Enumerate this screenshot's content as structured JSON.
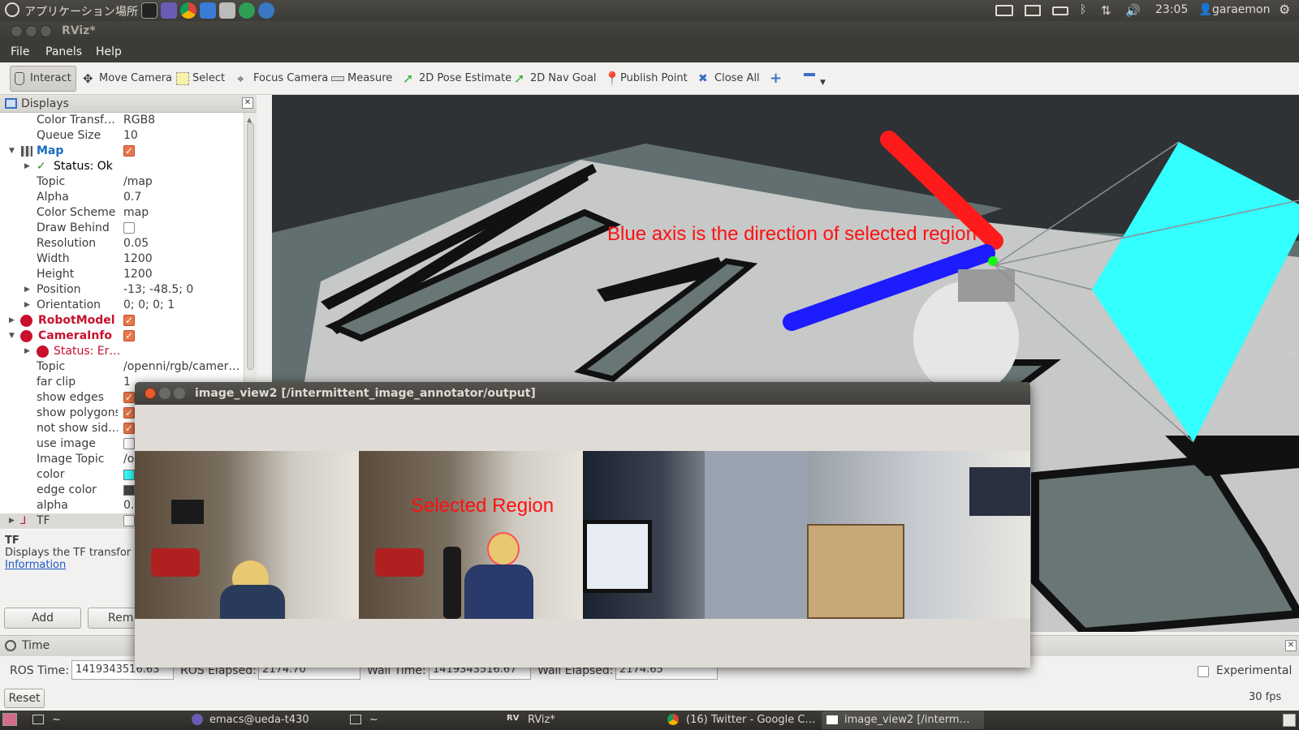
{
  "topbar": {
    "applications": "アプリケーション",
    "places": "場所",
    "clock": "23:05",
    "user": "garaemon"
  },
  "window": {
    "title": "RViz*"
  },
  "menu": {
    "file": "File",
    "panels": "Panels",
    "help": "Help"
  },
  "toolbar": {
    "interact": "Interact",
    "move_camera": "Move Camera",
    "select": "Select",
    "focus_camera": "Focus Camera",
    "measure": "Measure",
    "pose_estimate": "2D Pose Estimate",
    "nav_goal": "2D Nav Goal",
    "publish_point": "Publish Point",
    "close_all": "Close All"
  },
  "displays": {
    "title": "Displays",
    "rows": {
      "color_transf_k": "Color Transf…",
      "color_transf_v": "RGB8",
      "queue_k": "Queue Size",
      "queue_v": "10",
      "map": "Map",
      "status_ok": "Status: Ok",
      "topic_k": "Topic",
      "topic_v": "/map",
      "alpha_k": "Alpha",
      "alpha_v": "0.7",
      "scheme_k": "Color Scheme",
      "scheme_v": "map",
      "draw_behind_k": "Draw Behind",
      "resolution_k": "Resolution",
      "resolution_v": "0.05",
      "width_k": "Width",
      "width_v": "1200",
      "height_k": "Height",
      "height_v": "1200",
      "position_k": "Position",
      "position_v": "-13; -48.5; 0",
      "orientation_k": "Orientation",
      "orientation_v": "0; 0; 0; 1",
      "robotmodel": "RobotModel",
      "camerainfo": "CameraInfo",
      "status_err": "Status: Er…",
      "topic2_k": "Topic",
      "topic2_v": "/openni/rgb/camer…",
      "farclip_k": "far clip",
      "farclip_v": "1",
      "show_edges_k": "show edges",
      "show_polygons_k": "show polygons",
      "not_show_k": "not show sid…",
      "use_image_k": "use image",
      "image_topic_k": "Image Topic",
      "image_topic_v": "/o",
      "color_k": "color",
      "edge_color_k": "edge color",
      "alpha2_k": "alpha",
      "alpha2_v": "0.",
      "tf": "TF"
    },
    "desc_title": "TF",
    "desc_text": "Displays the TF transfor",
    "desc_link": "Information",
    "add_button": "Add",
    "remove_button": "Rem"
  },
  "viewport": {
    "annotation": "Blue axis is the direction of selected region"
  },
  "image_window": {
    "title": "image_view2 [/intermittent_image_annotator/output]",
    "selected_label": "Selected Region"
  },
  "time": {
    "title": "Time",
    "ros_time_label": "ROS Time:",
    "ros_time": "1419343516.63",
    "ros_elapsed_label": "ROS Elapsed:",
    "ros_elapsed": "2174.70",
    "wall_time_label": "Wall Time:",
    "wall_time": "1419343516.67",
    "wall_elapsed_label": "Wall Elapsed:",
    "wall_elapsed": "2174.65",
    "experimental": "Experimental",
    "reset": "Reset",
    "fps": "30 fps"
  },
  "taskbar": {
    "term1": "~",
    "emacs": "emacs@ueda-t430",
    "term2": "~",
    "rviz": "RViz*",
    "twitter": "(16) Twitter - Google C…",
    "imageview": "image_view2 [/interm…"
  },
  "colors": {
    "accent_orange": "#e8764a",
    "map_name_blue": "#1a6bc4",
    "error_red": "#c8102e",
    "annotation_red": "#ff1010",
    "cyan_plane": "#33ffff"
  }
}
